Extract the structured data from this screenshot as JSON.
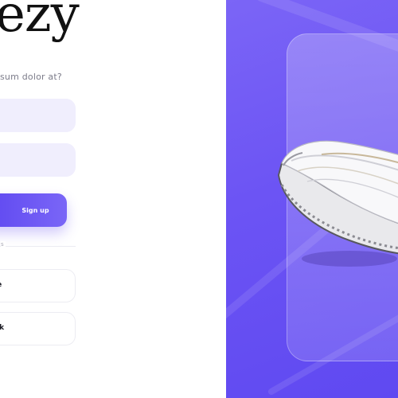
{
  "brand": {
    "logo_text": "ezy"
  },
  "form": {
    "subtitle": "sum dolor at?",
    "field_1_value": "",
    "field_2_value": "",
    "signup_label": "Sign up",
    "divider_label": "s",
    "social_1_label": "le",
    "social_2_label": "ok"
  },
  "colors": {
    "accent": "#6c54f4",
    "accent_light": "#7a66f7",
    "input_bg": "#f0eefd",
    "subtitle_text": "#7c7c8a",
    "hero_bg": "#6c54f4"
  },
  "hero": {
    "image": "sneaker-image"
  }
}
